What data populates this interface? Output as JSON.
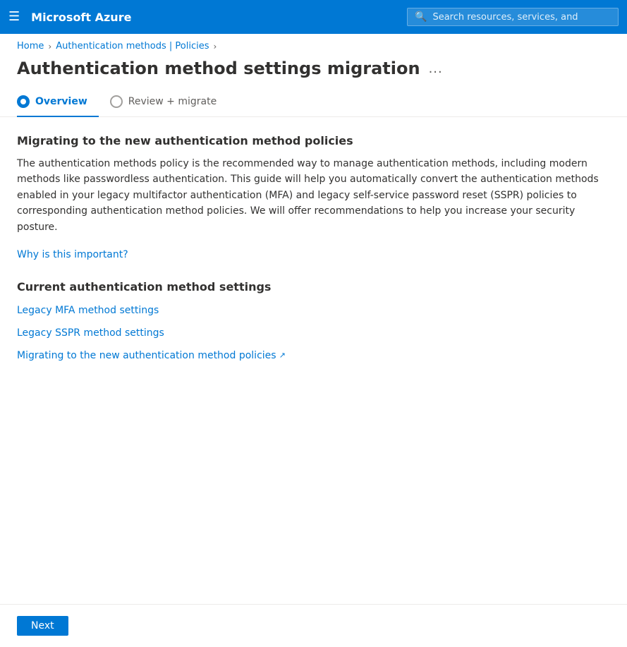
{
  "nav": {
    "hamburger_label": "☰",
    "logo": "Microsoft Azure",
    "search_placeholder": "Search resources, services, and"
  },
  "breadcrumb": {
    "home": "Home",
    "parent": "Authentication methods | Policies"
  },
  "header": {
    "title": "Authentication method settings migration",
    "more_icon": "..."
  },
  "tabs": [
    {
      "id": "overview",
      "label": "Overview",
      "state": "active"
    },
    {
      "id": "review",
      "label": "Review + migrate",
      "state": "inactive"
    }
  ],
  "overview": {
    "migrating_heading": "Migrating to the new authentication method policies",
    "body_text": "The authentication methods policy is the recommended way to manage authentication methods, including modern methods like passwordless authentication. This guide will help you automatically convert the authentication methods enabled in your legacy multifactor authentication (MFA) and legacy self-service password reset (SSPR) policies to corresponding authentication method policies. We will offer recommendations to help you increase your security posture.",
    "why_link": "Why is this important?",
    "current_heading": "Current authentication method settings",
    "links": [
      {
        "label": "Legacy MFA method settings",
        "external": false
      },
      {
        "label": "Legacy SSPR method settings",
        "external": false
      },
      {
        "label": "Migrating to the new authentication method policies",
        "external": true
      }
    ]
  },
  "footer": {
    "next_button": "Next"
  }
}
